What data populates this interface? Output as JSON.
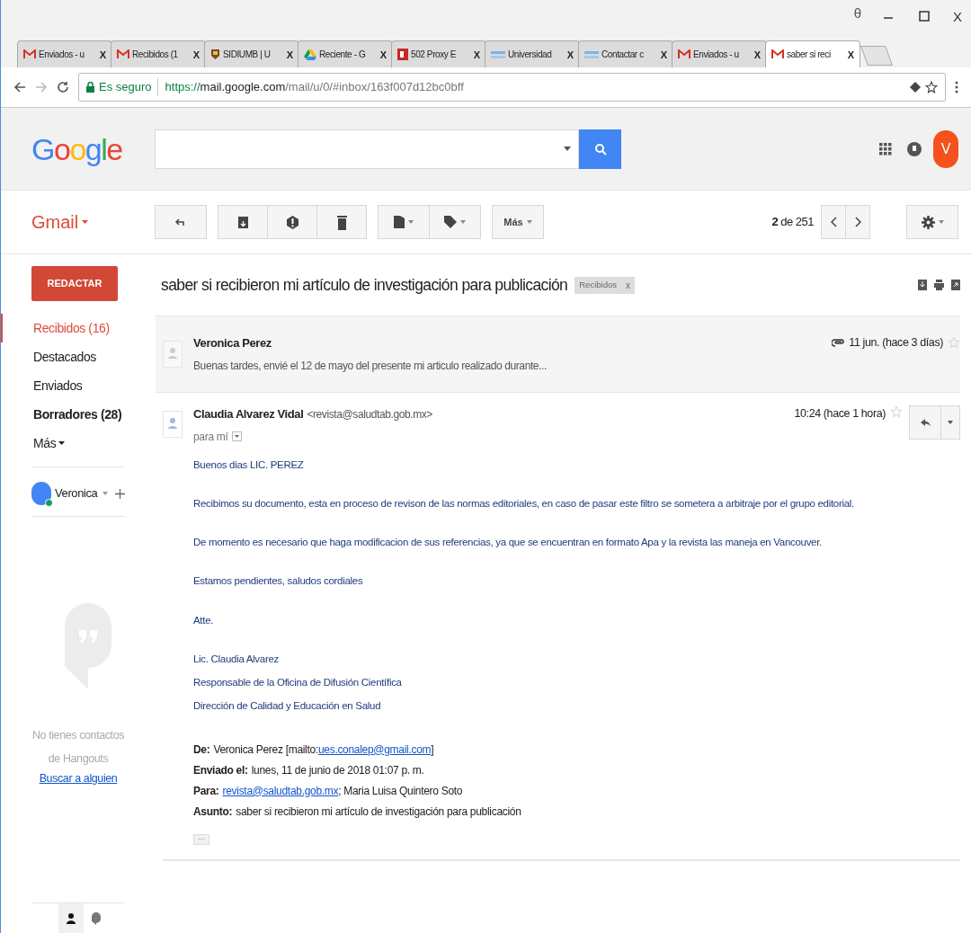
{
  "browser": {
    "profile_icon": "θ",
    "tabs": [
      {
        "kind": "gmail",
        "title": "Enviados - u",
        "close": "X",
        "selected": false
      },
      {
        "kind": "gmail",
        "title": "Recibidos (1",
        "close": "X",
        "selected": false
      },
      {
        "kind": "shield",
        "title": "SIDIUMB | U",
        "close": "X",
        "selected": false
      },
      {
        "kind": "drive",
        "title": "Reciente - G",
        "close": "X",
        "selected": false
      },
      {
        "kind": "error",
        "title": "502 Proxy E",
        "close": "X",
        "selected": false
      },
      {
        "kind": "uch",
        "title": "Universidad",
        "close": "X",
        "selected": false
      },
      {
        "kind": "uch",
        "title": "Contactar c",
        "close": "X",
        "selected": false
      },
      {
        "kind": "gmail",
        "title": "Enviados - u",
        "close": "X",
        "selected": false
      },
      {
        "kind": "gmail",
        "title": "saber si reci",
        "close": "X",
        "selected": true
      }
    ],
    "window_close": "X",
    "secure_label": "Es seguro",
    "url_scheme": "https://",
    "url_host": "mail.google.com",
    "url_path": "/mail/u/0/#inbox/163f007d12bc0bff"
  },
  "header": {
    "logo": [
      "G",
      "o",
      "o",
      "g",
      "l",
      "e"
    ],
    "avatar": "V"
  },
  "toolbar": {
    "app": "Gmail",
    "more": "Más",
    "counter_current": "2",
    "counter_rest": "de 251"
  },
  "sidebar": {
    "compose": "REDACTAR",
    "items": [
      {
        "label": "Recibidos (16)",
        "selected": true,
        "bold": false
      },
      {
        "label": "Destacados",
        "selected": false,
        "bold": false
      },
      {
        "label": "Enviados",
        "selected": false,
        "bold": false
      },
      {
        "label": "Borradores (28)",
        "selected": false,
        "bold": true
      },
      {
        "label": "Más",
        "selected": false,
        "bold": false
      }
    ],
    "user": "Veronica",
    "hangouts_empty": "No tienes contactos de Hangouts",
    "find_link": "Buscar a alguien"
  },
  "thread": {
    "subject": "saber si recibieron mi artículo de investigación para publicación",
    "label": "Recibidos",
    "label_remove": "x",
    "messages": [
      {
        "kind": "collapsed",
        "sender": "Veronica Perez",
        "snippet": "Buenas tardes, envié el 12 de mayo del presente mi articulo realizado durante...",
        "date": "11 jun. (hace 3 días)",
        "attachment": true,
        "starred": false
      },
      {
        "kind": "expanded",
        "sender": "Claudia Alvarez Vidal",
        "email": "<revista@saludtab.gob.mx>",
        "recipient": "para mí",
        "date": "10:24 (hace 1 hora)",
        "starred": false,
        "paragraphs": [
          [
            "Buenos dias LIC. PEREZ"
          ],
          [
            "Recibimos su documento, esta en proceso de revison de las normas editoriales, en caso de pasar este filtro se sometera a arbitraje por el grupo editorial."
          ],
          [
            "De momento es necesario que haga modificacion de sus referencias, ya que se encuentran en formato Apa y la revista las maneja en Vancouver."
          ],
          [
            "Estamos pendientes, saludos cordiales"
          ],
          [
            "Atte."
          ],
          [
            "Lic. Claudia Alvarez",
            "Responsable de la Oficina de Difusión Científica",
            "Dirección de Calidad y Educación en Salud"
          ]
        ],
        "quoted": [
          {
            "label": "De:",
            "parts": [
              {
                "text": "Veronica Perez [mailto:",
                "kind": "text"
              },
              {
                "text": "ues.conalep@gmail.com",
                "kind": "link"
              },
              {
                "text": "]",
                "kind": "text"
              }
            ]
          },
          {
            "label": "Enviado el:",
            "parts": [
              {
                "text": "lunes, 11 de junio de 2018 01:07 p. m.",
                "kind": "text"
              }
            ]
          },
          {
            "label": "Para:",
            "parts": [
              {
                "text": "revista@saludtab.gob.mx",
                "kind": "link"
              },
              {
                "text": "; Maria Luisa Quintero Soto",
                "kind": "text"
              }
            ]
          },
          {
            "label": "Asunto:",
            "parts": [
              {
                "text": "saber si recibieron mi artículo de investigación para publicación",
                "kind": "text"
              }
            ]
          }
        ],
        "ellipsis": "···"
      }
    ]
  }
}
